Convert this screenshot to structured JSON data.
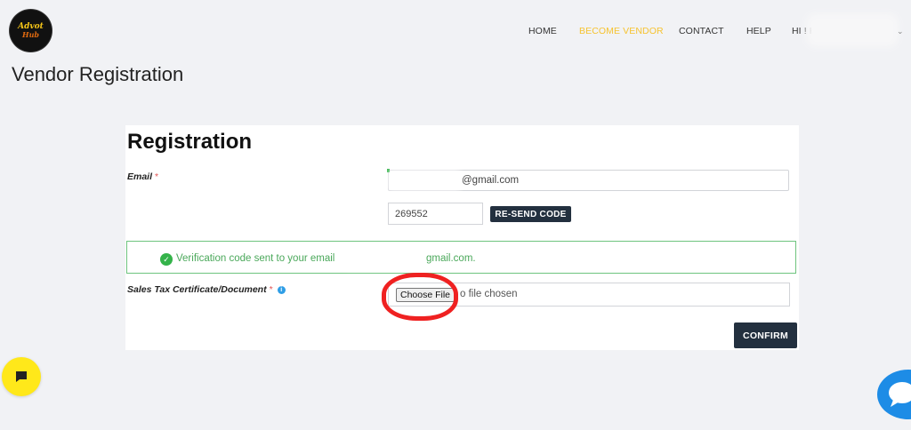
{
  "brand": {
    "logo_line1": "Advot",
    "logo_line2": "Hub"
  },
  "nav": {
    "items": [
      {
        "label": "HOME",
        "active": false
      },
      {
        "label": "BECOME VENDOR",
        "active": true
      },
      {
        "label": "CONTACT",
        "active": false
      },
      {
        "label": "HELP",
        "active": false
      }
    ],
    "user_label": "HI ! K",
    "active_color": "#f6c330"
  },
  "page": {
    "title": "Vendor Registration"
  },
  "form": {
    "heading": "Registration",
    "email_label": "Email",
    "required_mark": "*",
    "email_value_visible": "@gmail.com",
    "code_value": "269552",
    "resend_label": "RE-SEND CODE",
    "alert_text": "Verification code sent to your email",
    "alert_text_end": "gmail.com.",
    "doc_label": "Sales Tax Certificate/Document",
    "info_glyph": "i",
    "choose_file_label": "Choose File",
    "file_status": "o file chosen",
    "confirm_label": "CONFIRM"
  },
  "colors": {
    "button_dark": "#23303f",
    "success_green": "#34b34a",
    "highlight_red": "#ef2121",
    "chat_yellow": "#ffe81a",
    "chat_blue": "#1d8ce6"
  },
  "icons": {
    "check": "check-circle-icon",
    "info": "info-icon",
    "chat": "chat-bubble-icon",
    "caret": "chevron-down-icon"
  }
}
